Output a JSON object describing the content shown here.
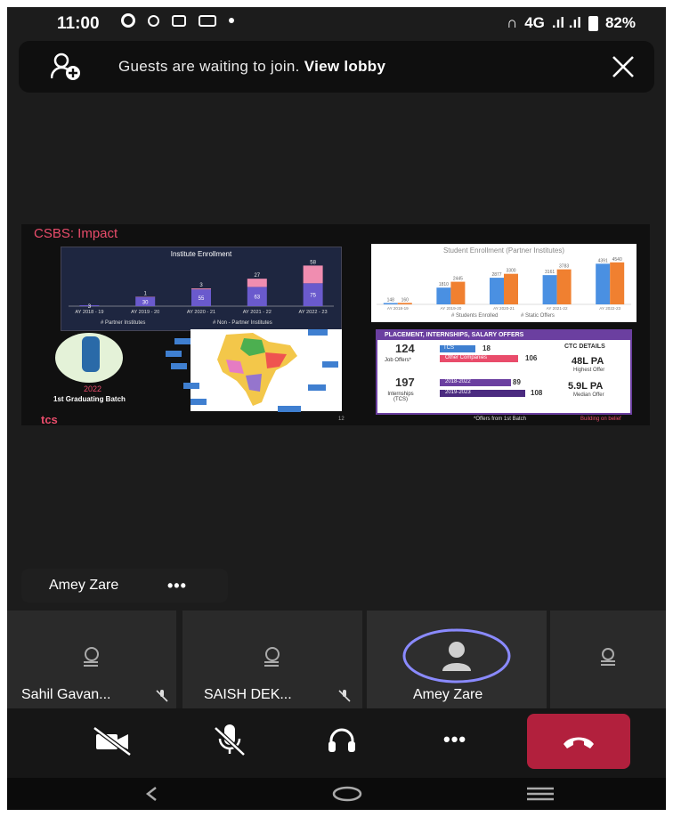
{
  "status_bar": {
    "time": "11:00",
    "network": "4G",
    "battery": "82%"
  },
  "lobby_banner": {
    "message": "Guests are waiting to join.",
    "action": "View lobby"
  },
  "slide": {
    "title": "CSBS: Impact",
    "enrollment_chart": {
      "title": "Institute Enrollment",
      "legend": [
        "# Partner Institutes",
        "# Non - Partner Institutes"
      ]
    },
    "student_chart": {
      "title": "Student Enrollment (Partner Institutes)",
      "legend": [
        "# Students Enrolled",
        "# Static Offers"
      ]
    },
    "graduating": {
      "year": "2022",
      "text": "1st Graduating Batch"
    },
    "placements": {
      "header": "PLACEMENT, INTERNSHIPS, SALARY OFFERS",
      "job_offers_value": "124",
      "job_offers_label": "Job Offers*",
      "tcs_label": "TCS",
      "tcs_value": "18",
      "other_label": "Other Companies",
      "other_value": "106",
      "internships_value": "197",
      "internships_label": "Internships (TCS)",
      "y1_label": "2018-2022",
      "y1_value": "89",
      "y2_label": "2019-2023",
      "y2_value": "108",
      "ctc_title": "CTC DETAILS",
      "highest_value": "48L PA",
      "highest_label": "Highest Offer",
      "median_value": "5.9L PA",
      "median_label": "Median Offer"
    },
    "footnote": "*Offers from 1st Batch",
    "tagline": "Building on belief",
    "logo": "tcs",
    "page_no": "12"
  },
  "chart_data": [
    {
      "type": "bar",
      "title": "Institute Enrollment",
      "categories": [
        "AY 2018 - 19",
        "AY 2019 - 20",
        "AY 2020 - 21",
        "AY 2021 - 22",
        "AY 2022 - 23"
      ],
      "series": [
        {
          "name": "# Partner Institutes",
          "values": [
            3,
            30,
            55,
            63,
            75
          ]
        },
        {
          "name": "# Non - Partner Institutes",
          "values": [
            0,
            1,
            3,
            27,
            58
          ]
        }
      ],
      "stacked": true,
      "colors": [
        "#6a5acd",
        "#f08db0"
      ]
    },
    {
      "type": "bar",
      "title": "Student Enrollment (Partner Institutes)",
      "categories": [
        "AY 2018-19",
        "AY 2019-20",
        "AY 2020-21",
        "AY 2021-22",
        "AY 2022-23"
      ],
      "series": [
        {
          "name": "# Students Enrolled",
          "values": [
            148,
            1810,
            2877,
            3161,
            4391
          ]
        },
        {
          "name": "# Static Offers",
          "values": [
            160,
            2445,
            3300,
            3783,
            4540
          ]
        }
      ],
      "colors": [
        "#4a90e2",
        "#f08030"
      ]
    }
  ],
  "active_speaker": {
    "name": "Amey Zare",
    "more": "•••"
  },
  "participants": [
    {
      "name": "Sahil Gavan...",
      "muted": true
    },
    {
      "name": "SAISH DEK...",
      "muted": true
    },
    {
      "name": "Amey Zare",
      "muted": false
    },
    {
      "name": "",
      "muted": false
    }
  ],
  "controls": {
    "more": "•••"
  },
  "colors": {
    "end_call": "#b2203d",
    "background": "#1c1c1c",
    "accent_ring": "#8a8aff"
  }
}
